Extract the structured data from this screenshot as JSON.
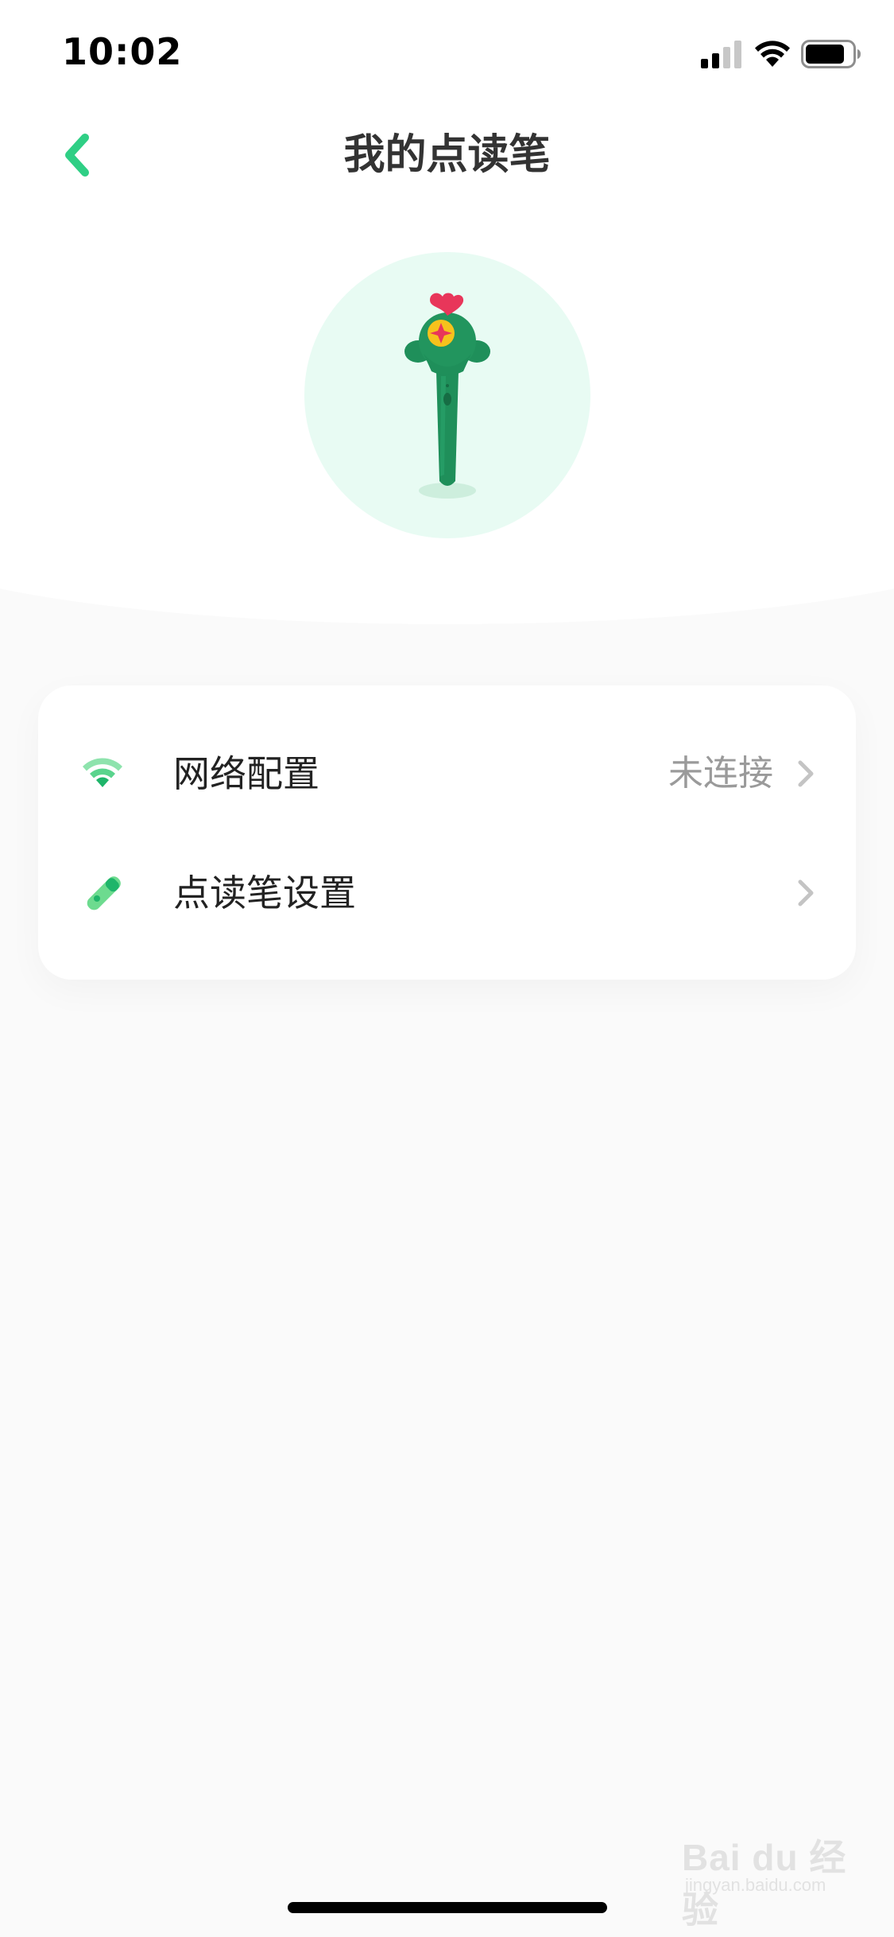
{
  "status_bar": {
    "time": "10:02"
  },
  "nav": {
    "title": "我的点读笔"
  },
  "menu": {
    "items": [
      {
        "label": "网络配置",
        "value": "未连接",
        "icon": "wifi-icon"
      },
      {
        "label": "点读笔设置",
        "value": "",
        "icon": "pen-icon"
      }
    ]
  },
  "watermark": {
    "main": "Bai du 经验",
    "sub": "jingyan.baidu.com"
  },
  "colors": {
    "accent": "#2fcf85",
    "circle_bg": "#e8fbf3",
    "pen_green": "#1f8f5a",
    "heart_red": "#e8365a"
  }
}
